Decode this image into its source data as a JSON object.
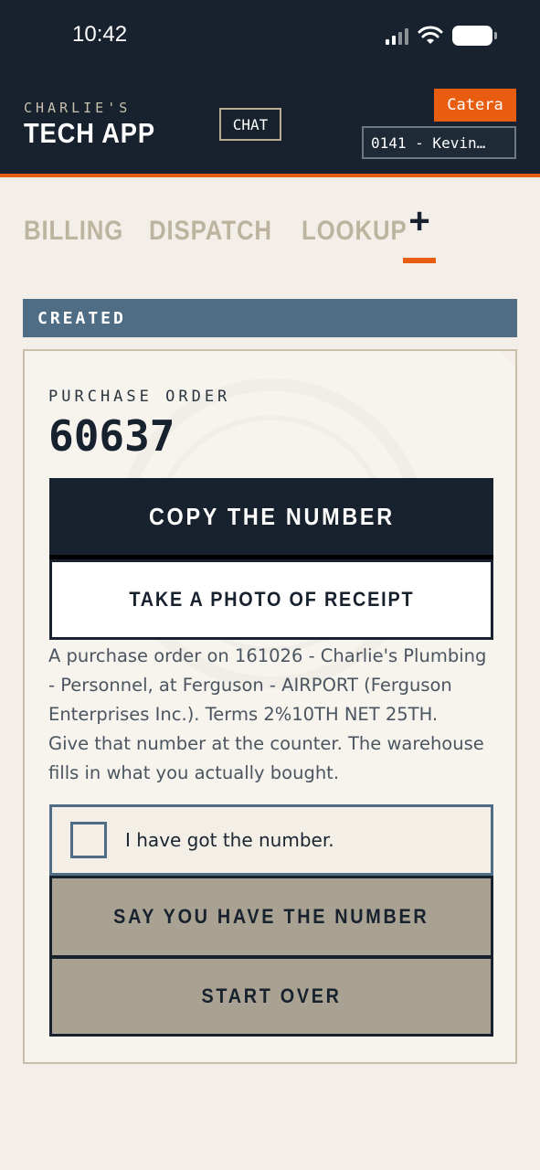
{
  "status_bar": {
    "time": "10:42",
    "icons": [
      "signal-icon",
      "wifi-icon",
      "battery-icon"
    ]
  },
  "header": {
    "brand_small": "CHARLIE'S",
    "brand_big": "TECH APP",
    "chat_label": "CHAT",
    "badge": "Catera",
    "account": "0141 - Kevin…"
  },
  "nav": {
    "tabs": [
      "BILLING",
      "DISPATCH",
      "LOOKUP"
    ],
    "plus": "+"
  },
  "status": {
    "label": "CREATED"
  },
  "card": {
    "po_label": "PURCHASE ORDER",
    "po_number": "60637",
    "copy_label": "COPY THE NUMBER",
    "photo_label": "TAKE A PHOTO OF RECEIPT",
    "description_line1": "A purchase order on 161026 - Charlie's Plumbing - Personnel, at Ferguson - AIRPORT (Ferguson Enterprises Inc.). Terms 2%10TH NET 25TH.",
    "description_line2": "Give that number at the counter. The warehouse fills in what you actually bought.",
    "check_label": "I have got the number.",
    "say_label": "SAY YOU HAVE THE NUMBER",
    "start_over_label": "START OVER"
  },
  "colors": {
    "header_bg": "#17222e",
    "accent": "#e85d10",
    "status_blue": "#4f6e85",
    "nav_inactive": "#bdb49f",
    "button_tan": "#a9a292"
  }
}
